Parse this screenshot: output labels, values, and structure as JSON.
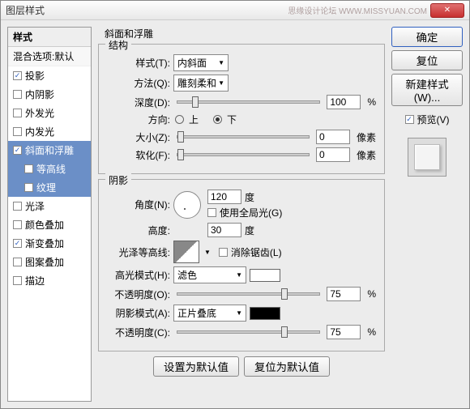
{
  "window": {
    "title": "图层样式",
    "watermark": "思缘设计论坛  WWW.MISSYUAN.COM"
  },
  "buttons": {
    "ok": "确定",
    "cancel": "复位",
    "newStyle": "新建样式(W)...",
    "preview": "预览(V)",
    "setDefault": "设置为默认值",
    "resetDefault": "复位为默认值"
  },
  "left": {
    "header": "样式",
    "blending": "混合选项:默认",
    "items": [
      {
        "label": "投影",
        "checked": true
      },
      {
        "label": "内阴影",
        "checked": false
      },
      {
        "label": "外发光",
        "checked": false
      },
      {
        "label": "内发光",
        "checked": false
      },
      {
        "label": "斜面和浮雕",
        "checked": true,
        "selected": true
      },
      {
        "label": "等高线",
        "checked": false,
        "sub": true,
        "selected": true
      },
      {
        "label": "纹理",
        "checked": false,
        "sub": true,
        "selected": true
      },
      {
        "label": "光泽",
        "checked": false
      },
      {
        "label": "颜色叠加",
        "checked": false
      },
      {
        "label": "渐变叠加",
        "checked": true
      },
      {
        "label": "图案叠加",
        "checked": false
      },
      {
        "label": "描边",
        "checked": false
      }
    ]
  },
  "panel": {
    "title": "斜面和浮雕",
    "structure": {
      "legend": "结构",
      "styleLabel": "样式(T):",
      "styleValue": "内斜面",
      "techLabel": "方法(Q):",
      "techValue": "雕刻柔和",
      "depthLabel": "深度(D):",
      "depthValue": "100",
      "depthUnit": "%",
      "dirLabel": "方向:",
      "dirUp": "上",
      "dirDown": "下",
      "sizeLabel": "大小(Z):",
      "sizeValue": "0",
      "sizeUnit": "像素",
      "softenLabel": "软化(F):",
      "softenValue": "0",
      "softenUnit": "像素"
    },
    "shading": {
      "legend": "阴影",
      "angleLabel": "角度(N):",
      "angleValue": "120",
      "angleUnit": "度",
      "useGlobal": "使用全局光(G)",
      "altLabel": "高度:",
      "altValue": "30",
      "altUnit": "度",
      "glossLabel": "光泽等高线:",
      "antialias": "消除锯齿(L)",
      "hiModeLabel": "高光模式(H):",
      "hiModeValue": "滤色",
      "hiOpLabel": "不透明度(O):",
      "hiOpValue": "75",
      "hiOpUnit": "%",
      "shModeLabel": "阴影模式(A):",
      "shModeValue": "正片叠底",
      "shOpLabel": "不透明度(C):",
      "shOpValue": "75",
      "shOpUnit": "%"
    }
  },
  "colors": {
    "highlight": "#ffffff",
    "shadow": "#000000"
  }
}
